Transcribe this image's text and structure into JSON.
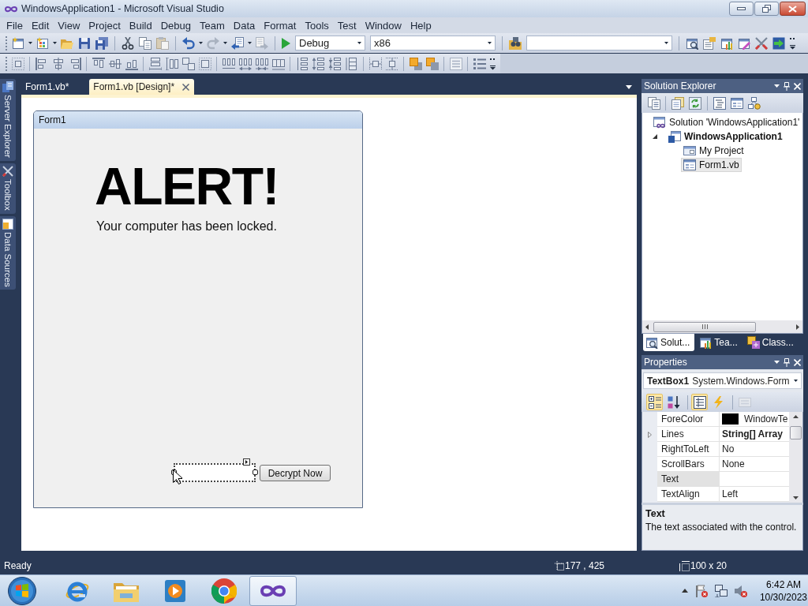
{
  "window": {
    "title": "WindowsApplication1 - Microsoft Visual Studio"
  },
  "menu": [
    "File",
    "Edit",
    "View",
    "Project",
    "Build",
    "Debug",
    "Team",
    "Data",
    "Format",
    "Tools",
    "Test",
    "Window",
    "Help"
  ],
  "toolbar": {
    "configuration": "Debug",
    "platform": "x86"
  },
  "side_tabs": [
    "Server Explorer",
    "Toolbox",
    "Data Sources"
  ],
  "document_tabs": [
    {
      "label": "Form1.vb*",
      "selected": false
    },
    {
      "label": "Form1.vb [Design]*",
      "selected": true
    }
  ],
  "designer": {
    "form_title": "Form1",
    "heading": "ALERT!",
    "message": "Your computer has been locked.",
    "textbox": {
      "selected": true
    },
    "button": "Decrypt Now"
  },
  "solution_explorer": {
    "title": "Solution Explorer",
    "tree": [
      {
        "label": "Solution 'WindowsApplication1'",
        "kind": "solution",
        "selected": false,
        "children": [
          {
            "label": "WindowsApplication1",
            "kind": "project",
            "selected": false,
            "expanded": true,
            "children": [
              {
                "label": "My Project",
                "kind": "settings",
                "selected": false
              },
              {
                "label": "Form1.vb",
                "kind": "form",
                "selected": true
              }
            ]
          }
        ]
      }
    ],
    "tabs": [
      {
        "label": "Solut...",
        "kind": "solution",
        "selected": true
      },
      {
        "label": "Tea...",
        "kind": "team",
        "selected": false
      },
      {
        "label": "Class...",
        "kind": "class",
        "selected": false
      }
    ]
  },
  "properties": {
    "title": "Properties",
    "object_name": "TextBox1",
    "object_type": "System.Windows.Form",
    "tools": [
      {
        "kind": "categorized",
        "selected": true,
        "disabled": false
      },
      {
        "kind": "alphabetical",
        "selected": false,
        "disabled": false
      },
      {
        "kind": "properties",
        "selected": true,
        "disabled": false
      },
      {
        "kind": "events",
        "selected": false,
        "disabled": false
      },
      {
        "kind": "pages",
        "selected": false,
        "disabled": true
      }
    ],
    "rows": [
      {
        "name": "ForeColor",
        "value": "WindowTe",
        "kind": "color",
        "color": "#000000",
        "modified": false,
        "selected": false
      },
      {
        "name": "Lines",
        "value": "String[] Array",
        "kind": "collection",
        "expanded": false,
        "modified": true,
        "selected": false
      },
      {
        "name": "RightToLeft",
        "value": "No",
        "kind": "text",
        "modified": false,
        "selected": false
      },
      {
        "name": "ScrollBars",
        "value": "None",
        "kind": "text",
        "modified": false,
        "selected": false
      },
      {
        "name": "Text",
        "kind": "text",
        "modified": false,
        "selected": true
      },
      {
        "name": "TextAlign",
        "value": "Left",
        "kind": "text",
        "modified": false,
        "selected": false
      }
    ],
    "description": {
      "title": "Text",
      "text": "The text associated with the control."
    }
  },
  "status_bar": {
    "message": "Ready",
    "position": "177 , 425",
    "size": "100 x 20"
  },
  "taskbar": {
    "apps": [
      {
        "kind": "browser",
        "selected": false
      },
      {
        "kind": "files",
        "selected": false
      },
      {
        "kind": "media",
        "selected": false
      },
      {
        "kind": "chrome",
        "selected": false
      },
      {
        "kind": "studio",
        "selected": true
      }
    ],
    "time": "6:42 AM",
    "date": "10/30/2023"
  }
}
